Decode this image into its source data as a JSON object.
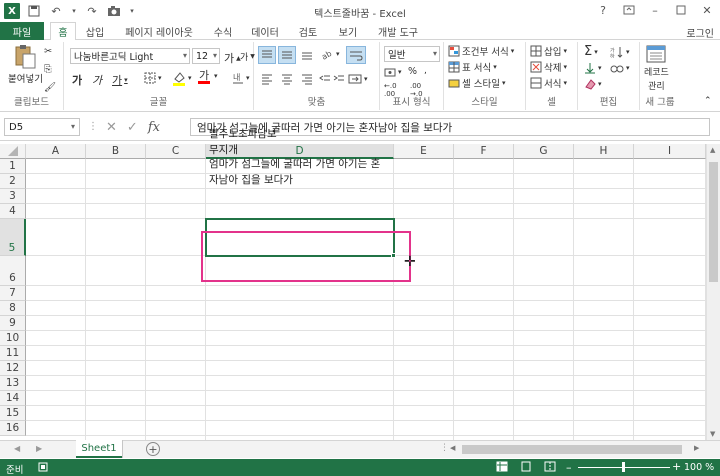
{
  "app": {
    "title": "텍스트줄바꿈 - Excel",
    "signin": "로그인",
    "logo": "X"
  },
  "tabs": {
    "file": "파일",
    "items": [
      "홈",
      "삽입",
      "페이지 레이아웃",
      "수식",
      "데이터",
      "검토",
      "보기",
      "개발 도구"
    ]
  },
  "ribbon": {
    "clipboard": {
      "paste": "붙여넣기",
      "label": "클립보드"
    },
    "font": {
      "name": "나눔바른고딕 Light",
      "size": "12",
      "label": "글꼴",
      "bold": "가",
      "italic": "가",
      "underline": "가",
      "grow": "가",
      "shrink": "가"
    },
    "align": {
      "label": "맞춤"
    },
    "number": {
      "format": "일반",
      "percent": "%",
      "label": "표시 형식"
    },
    "styles": {
      "cond": "조건부 서식",
      "table": "표 서식",
      "cell": "셀 스타일",
      "label": "스타일"
    },
    "cells": {
      "insert": "삽입",
      "delete": "삭제",
      "format": "서식",
      "label": "셀"
    },
    "editing": {
      "label": "편집"
    },
    "newgroup": {
      "btn1": "레코드",
      "btn2": "관리",
      "label": "새 그룹"
    }
  },
  "formula": {
    "namebox": "D5",
    "fx": "fx",
    "content": "엄마가 섬그늘에 굴따러 가면 아기는 혼자남아 집을 보다가"
  },
  "grid": {
    "columns": [
      "A",
      "B",
      "C",
      "D",
      "E",
      "F",
      "G",
      "H",
      "I"
    ],
    "rows": [
      "1",
      "2",
      "3",
      "4",
      "5",
      "6",
      "7",
      "8",
      "9",
      "10",
      "11",
      "12",
      "13",
      "14",
      "15",
      "16"
    ],
    "cells": {
      "d4_line1": "빨주노초파남보",
      "d4_line2": "무지개",
      "d5_line1": "엄마가 섬그늘에 굴따러 가면 아기는 혼",
      "d5_line2": "자남아 집을 보다가"
    }
  },
  "sheets": {
    "active": "Sheet1",
    "add": "+"
  },
  "status": {
    "ready": "준비",
    "zoom": "100 %"
  }
}
